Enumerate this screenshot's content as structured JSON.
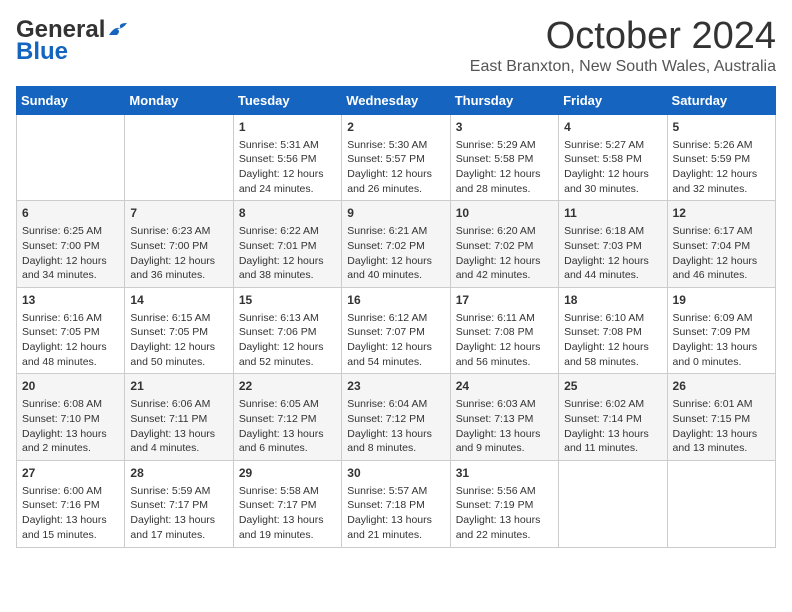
{
  "logo": {
    "line1": "General",
    "line2": "Blue"
  },
  "title": "October 2024",
  "location": "East Branxton, New South Wales, Australia",
  "weekdays": [
    "Sunday",
    "Monday",
    "Tuesday",
    "Wednesday",
    "Thursday",
    "Friday",
    "Saturday"
  ],
  "weeks": [
    [
      {
        "day": null,
        "info": null
      },
      {
        "day": null,
        "info": null
      },
      {
        "day": "1",
        "info": "Sunrise: 5:31 AM\nSunset: 5:56 PM\nDaylight: 12 hours\nand 24 minutes."
      },
      {
        "day": "2",
        "info": "Sunrise: 5:30 AM\nSunset: 5:57 PM\nDaylight: 12 hours\nand 26 minutes."
      },
      {
        "day": "3",
        "info": "Sunrise: 5:29 AM\nSunset: 5:58 PM\nDaylight: 12 hours\nand 28 minutes."
      },
      {
        "day": "4",
        "info": "Sunrise: 5:27 AM\nSunset: 5:58 PM\nDaylight: 12 hours\nand 30 minutes."
      },
      {
        "day": "5",
        "info": "Sunrise: 5:26 AM\nSunset: 5:59 PM\nDaylight: 12 hours\nand 32 minutes."
      }
    ],
    [
      {
        "day": "6",
        "info": "Sunrise: 6:25 AM\nSunset: 7:00 PM\nDaylight: 12 hours\nand 34 minutes."
      },
      {
        "day": "7",
        "info": "Sunrise: 6:23 AM\nSunset: 7:00 PM\nDaylight: 12 hours\nand 36 minutes."
      },
      {
        "day": "8",
        "info": "Sunrise: 6:22 AM\nSunset: 7:01 PM\nDaylight: 12 hours\nand 38 minutes."
      },
      {
        "day": "9",
        "info": "Sunrise: 6:21 AM\nSunset: 7:02 PM\nDaylight: 12 hours\nand 40 minutes."
      },
      {
        "day": "10",
        "info": "Sunrise: 6:20 AM\nSunset: 7:02 PM\nDaylight: 12 hours\nand 42 minutes."
      },
      {
        "day": "11",
        "info": "Sunrise: 6:18 AM\nSunset: 7:03 PM\nDaylight: 12 hours\nand 44 minutes."
      },
      {
        "day": "12",
        "info": "Sunrise: 6:17 AM\nSunset: 7:04 PM\nDaylight: 12 hours\nand 46 minutes."
      }
    ],
    [
      {
        "day": "13",
        "info": "Sunrise: 6:16 AM\nSunset: 7:05 PM\nDaylight: 12 hours\nand 48 minutes."
      },
      {
        "day": "14",
        "info": "Sunrise: 6:15 AM\nSunset: 7:05 PM\nDaylight: 12 hours\nand 50 minutes."
      },
      {
        "day": "15",
        "info": "Sunrise: 6:13 AM\nSunset: 7:06 PM\nDaylight: 12 hours\nand 52 minutes."
      },
      {
        "day": "16",
        "info": "Sunrise: 6:12 AM\nSunset: 7:07 PM\nDaylight: 12 hours\nand 54 minutes."
      },
      {
        "day": "17",
        "info": "Sunrise: 6:11 AM\nSunset: 7:08 PM\nDaylight: 12 hours\nand 56 minutes."
      },
      {
        "day": "18",
        "info": "Sunrise: 6:10 AM\nSunset: 7:08 PM\nDaylight: 12 hours\nand 58 minutes."
      },
      {
        "day": "19",
        "info": "Sunrise: 6:09 AM\nSunset: 7:09 PM\nDaylight: 13 hours\nand 0 minutes."
      }
    ],
    [
      {
        "day": "20",
        "info": "Sunrise: 6:08 AM\nSunset: 7:10 PM\nDaylight: 13 hours\nand 2 minutes."
      },
      {
        "day": "21",
        "info": "Sunrise: 6:06 AM\nSunset: 7:11 PM\nDaylight: 13 hours\nand 4 minutes."
      },
      {
        "day": "22",
        "info": "Sunrise: 6:05 AM\nSunset: 7:12 PM\nDaylight: 13 hours\nand 6 minutes."
      },
      {
        "day": "23",
        "info": "Sunrise: 6:04 AM\nSunset: 7:12 PM\nDaylight: 13 hours\nand 8 minutes."
      },
      {
        "day": "24",
        "info": "Sunrise: 6:03 AM\nSunset: 7:13 PM\nDaylight: 13 hours\nand 9 minutes."
      },
      {
        "day": "25",
        "info": "Sunrise: 6:02 AM\nSunset: 7:14 PM\nDaylight: 13 hours\nand 11 minutes."
      },
      {
        "day": "26",
        "info": "Sunrise: 6:01 AM\nSunset: 7:15 PM\nDaylight: 13 hours\nand 13 minutes."
      }
    ],
    [
      {
        "day": "27",
        "info": "Sunrise: 6:00 AM\nSunset: 7:16 PM\nDaylight: 13 hours\nand 15 minutes."
      },
      {
        "day": "28",
        "info": "Sunrise: 5:59 AM\nSunset: 7:17 PM\nDaylight: 13 hours\nand 17 minutes."
      },
      {
        "day": "29",
        "info": "Sunrise: 5:58 AM\nSunset: 7:17 PM\nDaylight: 13 hours\nand 19 minutes."
      },
      {
        "day": "30",
        "info": "Sunrise: 5:57 AM\nSunset: 7:18 PM\nDaylight: 13 hours\nand 21 minutes."
      },
      {
        "day": "31",
        "info": "Sunrise: 5:56 AM\nSunset: 7:19 PM\nDaylight: 13 hours\nand 22 minutes."
      },
      {
        "day": null,
        "info": null
      },
      {
        "day": null,
        "info": null
      }
    ]
  ]
}
